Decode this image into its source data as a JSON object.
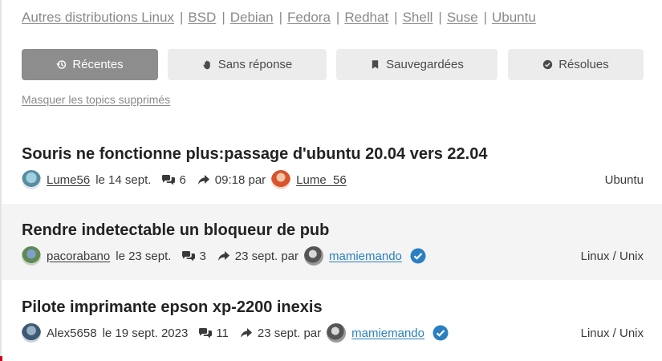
{
  "subforums": [
    "Autres distributions Linux",
    "BSD",
    "Debian",
    "Fedora",
    "Redhat",
    "Shell",
    "Suse",
    "Ubuntu"
  ],
  "separator": "|",
  "tabs": [
    {
      "label": "Récentes",
      "icon": "history-icon",
      "active": true
    },
    {
      "label": "Sans réponse",
      "icon": "hand-icon",
      "active": false
    },
    {
      "label": "Sauvegardées",
      "icon": "bookmark-icon",
      "active": false
    },
    {
      "label": "Résolues",
      "icon": "check-circle-icon",
      "active": false
    }
  ],
  "hide_deleted_label": "Masquer les topics supprimés",
  "topics": [
    {
      "title": "Souris ne fonctionne plus:passage d'ubuntu 20.04 vers 22.04",
      "author": "Lume56",
      "date": "le 14 sept.",
      "comments": "6",
      "last_time": "09:18 par",
      "last_author": "Lume_56",
      "verified": false,
      "category": "Ubuntu"
    },
    {
      "title": "Rendre indetectable un bloqueur de pub",
      "author": "pacorabano",
      "date": "le 23 sept.",
      "comments": "3",
      "last_time": "23 sept. par",
      "last_author": "mamiemando",
      "verified": true,
      "category": "Linux / Unix"
    },
    {
      "title": "Pilote imprimante epson xp-2200 inexis",
      "author": "Alex5658",
      "date": "le 19 sept. 2023",
      "comments": "11",
      "last_time": "23 sept. par",
      "last_author": "mamiemando",
      "verified": true,
      "category": "Linux / Unix"
    }
  ],
  "colors": {
    "active_tab": "#8d8d8d",
    "tab": "#ececec",
    "link_blue": "#2a7fc1",
    "verified": "#2a7fc1",
    "alt_row": "#f4f4f4"
  }
}
